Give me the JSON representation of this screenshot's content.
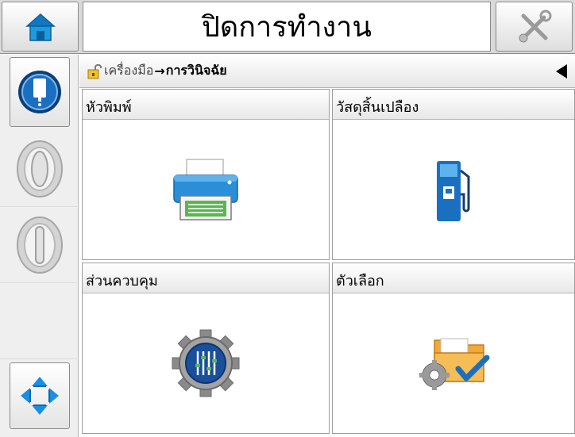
{
  "title": "ปิดการทำงาน",
  "breadcrumb": {
    "root": "เครื่องมือ",
    "separator": "→",
    "current": "การวินิจฉัย"
  },
  "tiles": [
    {
      "label": "หัวพิมพ์",
      "icon": "printer-icon"
    },
    {
      "label": "วัสดุสิ้นเปลือง",
      "icon": "fuel-pump-icon"
    },
    {
      "label": "ส่วนควบคุม",
      "icon": "gear-equalizer-icon"
    },
    {
      "label": "ตัวเลือก",
      "icon": "folder-gear-check-icon"
    }
  ],
  "colors": {
    "accent_blue": "#1a6fc0",
    "printer_blue": "#2a8fd8",
    "green": "#5bb551",
    "folder_orange": "#f0a838",
    "gear_gray": "#8a8a8a"
  }
}
